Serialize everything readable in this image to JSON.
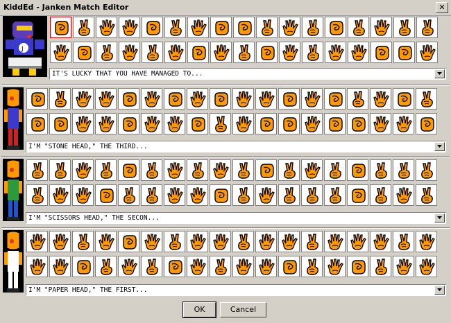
{
  "window": {
    "title": "KiddEd - Janken Match Editor",
    "close_glyph": "✕"
  },
  "colors": {
    "hand_fill": "#ff9900",
    "hand_outline": "#000000",
    "selected_border": "#cc0000"
  },
  "sections": [
    {
      "character": "boss",
      "dialog": "IT'S LUCKY THAT YOU HAVE MANAGED TO...",
      "moves": [
        [
          "rock",
          "scissors",
          "paper",
          "paper",
          "rock",
          "scissors",
          "paper",
          "rock",
          "rock",
          "scissors",
          "paper",
          "scissors",
          "rock",
          "scissors",
          "paper",
          "scissors",
          "scissors"
        ],
        [
          "paper",
          "rock",
          "scissors",
          "paper",
          "scissors",
          "paper",
          "rock",
          "paper",
          "scissors",
          "rock",
          "paper",
          "scissors",
          "paper",
          "paper",
          "rock",
          "rock",
          "paper"
        ]
      ],
      "selected": [
        0,
        0
      ]
    },
    {
      "character": "stone-head",
      "dialog": "I'M \"STONE HEAD,\" THE THIRD...",
      "moves": [
        [
          "rock",
          "scissors",
          "paper",
          "paper",
          "rock",
          "paper",
          "rock",
          "paper",
          "rock",
          "paper",
          "paper",
          "rock",
          "paper",
          "rock",
          "scissors",
          "paper",
          "rock",
          "scissors"
        ],
        [
          "rock",
          "rock",
          "paper",
          "paper",
          "rock",
          "paper",
          "paper",
          "rock",
          "scissors",
          "paper",
          "rock",
          "rock",
          "paper",
          "rock",
          "rock",
          "paper",
          "paper",
          "rock"
        ]
      ]
    },
    {
      "character": "scissors-head",
      "dialog": "I'M \"SCISSORS HEAD,\" THE SECON...",
      "moves": [
        [
          "scissors",
          "scissors",
          "paper",
          "scissors",
          "rock",
          "scissors",
          "paper",
          "scissors",
          "paper",
          "scissors",
          "rock",
          "scissors",
          "paper",
          "scissors",
          "rock",
          "scissors",
          "scissors",
          "scissors"
        ],
        [
          "scissors",
          "paper",
          "paper",
          "rock",
          "scissors",
          "scissors",
          "paper",
          "paper",
          "rock",
          "scissors",
          "paper",
          "scissors",
          "scissors",
          "scissors",
          "rock",
          "scissors",
          "paper",
          "scissors"
        ]
      ]
    },
    {
      "character": "paper-head",
      "dialog": "I'M \"PAPER HEAD,\" THE FIRST...",
      "moves": [
        [
          "paper",
          "paper",
          "scissors",
          "paper",
          "rock",
          "paper",
          "scissors",
          "paper",
          "paper",
          "scissors",
          "paper",
          "paper",
          "scissors",
          "paper",
          "paper",
          "paper",
          "scissors",
          "paper"
        ],
        [
          "paper",
          "paper",
          "rock",
          "scissors",
          "paper",
          "scissors",
          "rock",
          "paper",
          "scissors",
          "paper",
          "paper",
          "rock",
          "scissors",
          "paper",
          "rock",
          "scissors",
          "paper",
          "paper"
        ]
      ]
    }
  ],
  "buttons": {
    "ok": "OK",
    "cancel": "Cancel"
  },
  "icons": {
    "dropdown": "chevron-down-icon",
    "close": "close-icon"
  }
}
